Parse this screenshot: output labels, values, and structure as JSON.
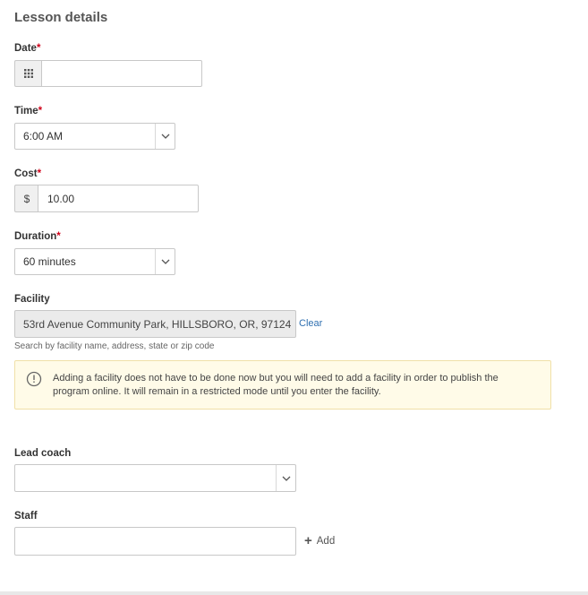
{
  "section": {
    "title": "Lesson details"
  },
  "date": {
    "label": "Date",
    "required_mark": "*",
    "value": "",
    "icon": "calendar-grid-icon"
  },
  "time": {
    "label": "Time",
    "required_mark": "*",
    "selected": "6:00 AM"
  },
  "cost": {
    "label": "Cost",
    "required_mark": "*",
    "currency": "$",
    "value": "10.00"
  },
  "duration": {
    "label": "Duration",
    "required_mark": "*",
    "selected": "60 minutes"
  },
  "facility": {
    "label": "Facility",
    "value": "53rd Avenue Community Park, HILLSBORO, OR, 97124",
    "clear_label": "Clear",
    "hint": "Search by facility name, address, state or zip code",
    "notice": "Adding a facility does not have to be done now but you will need to add a facility in order to publish the program online. It will remain in a restricted mode until you enter the facility."
  },
  "lead_coach": {
    "label": "Lead coach",
    "selected": ""
  },
  "staff": {
    "label": "Staff",
    "value": "",
    "add_label": "Add"
  },
  "colors": {
    "required": "#d0021b",
    "link": "#2e6fb0",
    "notice_bg": "#fffbe8",
    "notice_border": "#f0e0a8"
  }
}
